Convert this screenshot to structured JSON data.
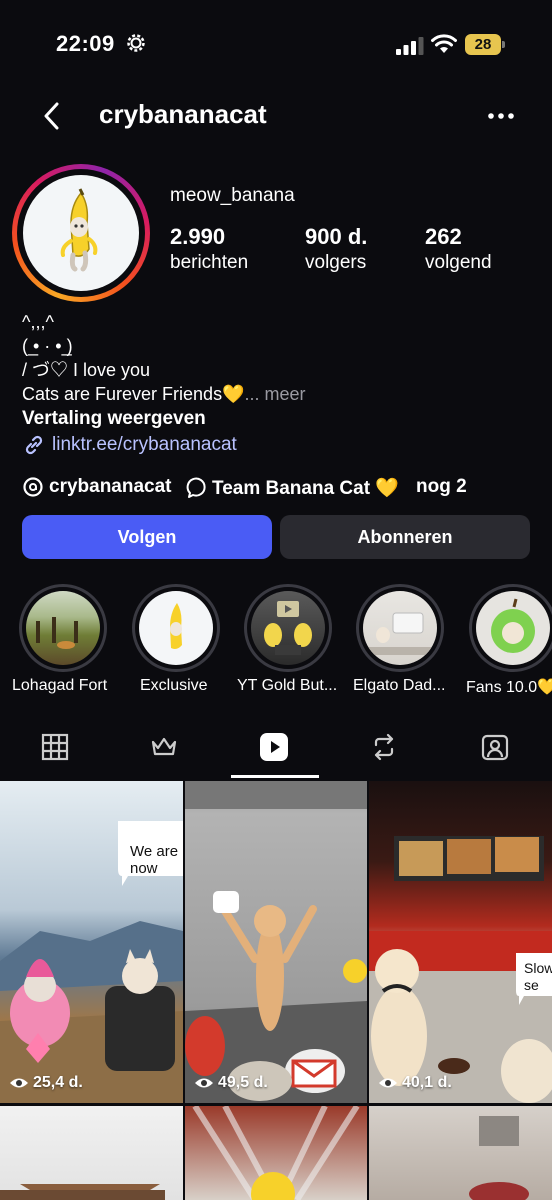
{
  "status": {
    "time": "22:09",
    "battery": "28"
  },
  "header": {
    "username": "crybananacat"
  },
  "profile": {
    "display_name": "meow_banana",
    "stats": [
      {
        "value": "2.990",
        "label": "berichten"
      },
      {
        "value": "900 d.",
        "label": "volgers"
      },
      {
        "value": "262",
        "label": "volgend"
      }
    ],
    "bio_lines": [
      "^,,,^",
      "( ̲•  ·  • ̲)",
      "/    づ♡ I love you",
      "Cats are Furever Friends💛"
    ],
    "more_label": "... meer",
    "translate_label": "Vertaling weergeven",
    "link": "linktr.ee/crybananacat",
    "threads_handle": "crybananacat",
    "channel_label": "Team Banana Cat 💛",
    "more_chips": "nog 2"
  },
  "actions": {
    "follow": "Volgen",
    "subscribe": "Abonneren"
  },
  "highlights": [
    {
      "label": "Lohagad Fort"
    },
    {
      "label": "Exclusive"
    },
    {
      "label": "YT Gold But..."
    },
    {
      "label": "Elgato Dad..."
    },
    {
      "label": "Fans 10.0💛"
    }
  ],
  "tabs": [
    "grid-icon",
    "crown-icon",
    "reels-icon",
    "repost-icon",
    "tagged-icon"
  ],
  "grid": [
    {
      "views": "25,4 d.",
      "bubble": "We are\nnow"
    },
    {
      "views": "49,5 d.",
      "bubble": ""
    },
    {
      "views": "40,1 d.",
      "bubble": "Slow\nse"
    }
  ]
}
